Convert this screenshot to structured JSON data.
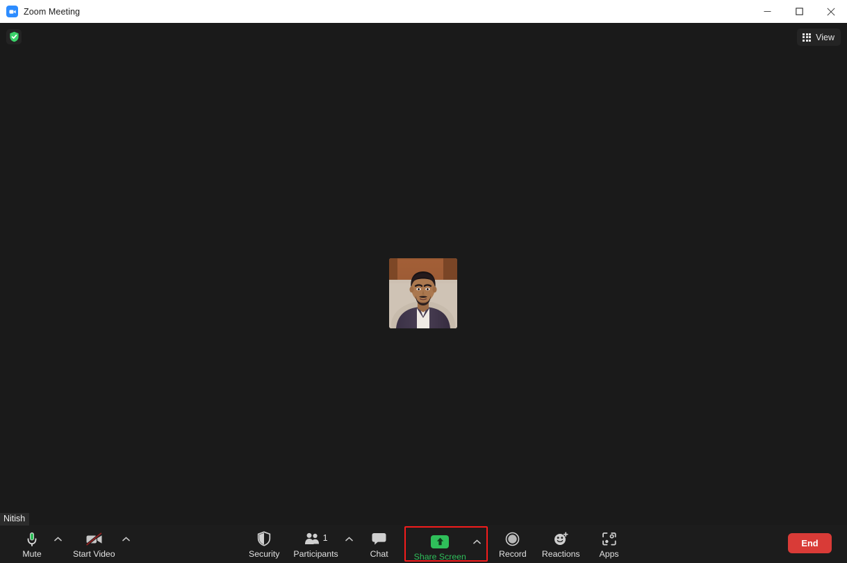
{
  "window": {
    "title": "Zoom Meeting",
    "app_icon": "zoom-video-icon",
    "controls": {
      "minimize": "minimize-icon",
      "maximize": "maximize-icon",
      "close": "close-icon"
    }
  },
  "stage": {
    "encryption_badge": "shield-check-icon",
    "view_button": {
      "label": "View",
      "icon": "grid-icon"
    },
    "participant_tile": {
      "name": "Nitish",
      "video_on": true
    }
  },
  "toolbar": {
    "self_name": "Nitish",
    "left_items": [
      {
        "label": "Mute",
        "icon": "microphone-icon",
        "has_caret": true,
        "state": "unmuted"
      },
      {
        "label": "Start Video",
        "icon": "video-off-icon",
        "has_caret": true,
        "state": "video-off"
      }
    ],
    "center_items": [
      {
        "label": "Security",
        "icon": "shield-icon",
        "has_caret": false
      },
      {
        "label": "Participants",
        "icon": "participants-icon",
        "count": "1",
        "has_caret": true
      },
      {
        "label": "Chat",
        "icon": "chat-bubble-icon",
        "has_caret": false
      },
      {
        "label": "Share Screen",
        "icon": "share-screen-icon",
        "has_caret": true,
        "highlighted": true
      },
      {
        "label": "Record",
        "icon": "record-icon",
        "has_caret": false
      },
      {
        "label": "Reactions",
        "icon": "reactions-icon",
        "has_caret": false
      },
      {
        "label": "Apps",
        "icon": "apps-icon",
        "has_caret": false
      }
    ],
    "end_button": {
      "label": "End"
    }
  },
  "colors": {
    "window_chrome": "#ffffff",
    "stage_background": "#1a1a1a",
    "toolbar_background": "#1c1c1c",
    "accent_green": "#2fbf5a",
    "highlight_red": "#f41c1c",
    "end_red": "#d93b37",
    "zoom_blue": "#2d8cff",
    "text_light": "#e2e2e2"
  }
}
